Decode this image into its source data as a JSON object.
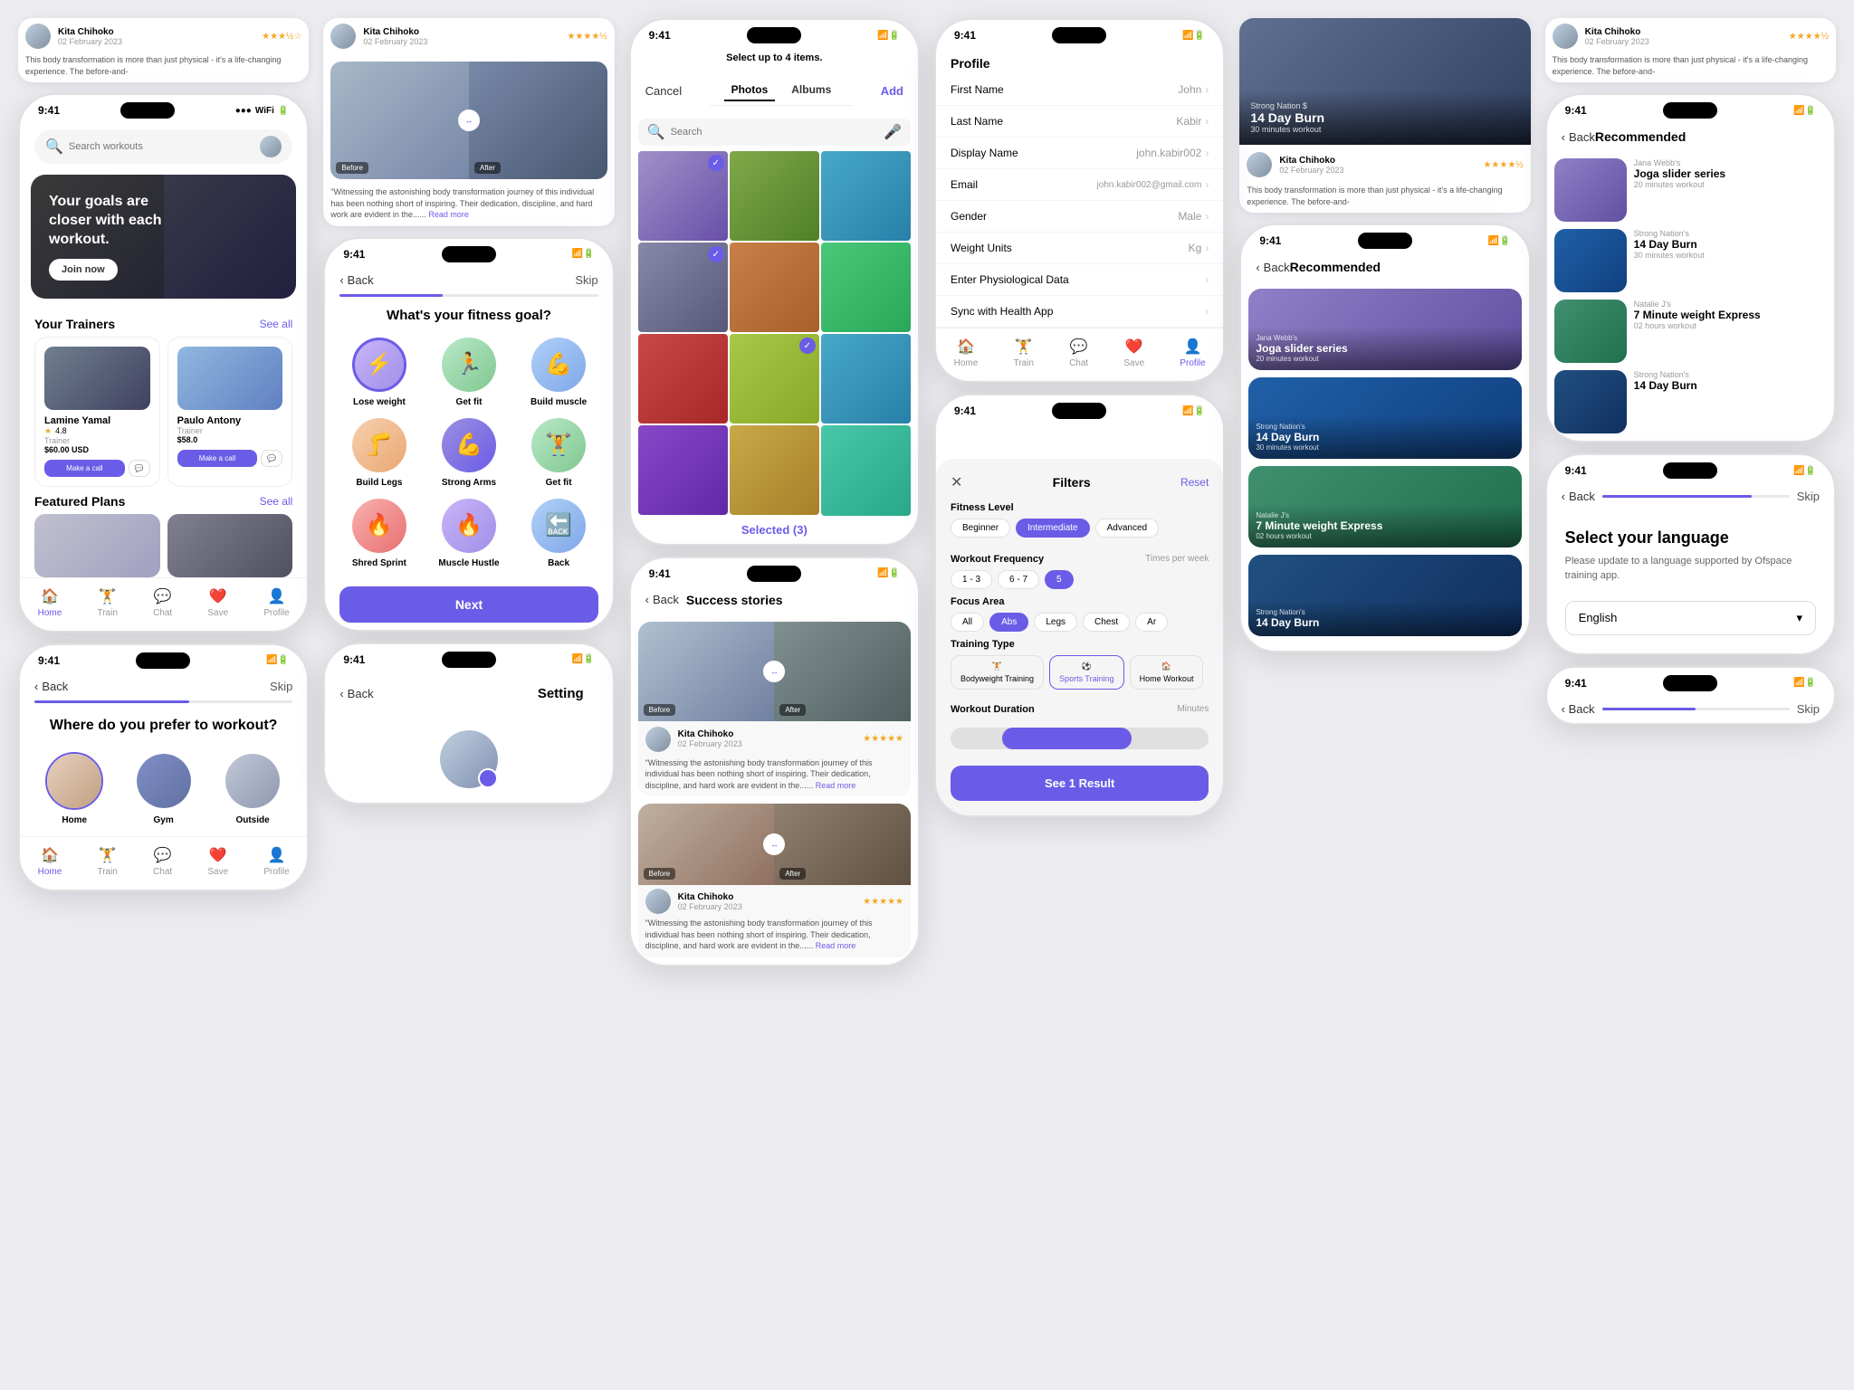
{
  "colors": {
    "primary": "#6B5CE7",
    "accent": "#f5a623",
    "bg": "#ebebf0",
    "white": "#ffffff"
  },
  "screen1": {
    "time": "9:41",
    "hero": {
      "title": "Your goals are closer with each workout.",
      "joinBtn": "Join now"
    },
    "trainers": {
      "sectionTitle": "Your Trainers",
      "seeAll": "See all",
      "list": [
        {
          "name": "Lamine Yamal",
          "role": "Trainer",
          "price": "$60.00 USD",
          "rating": "4.8",
          "btnLabel": "Make a call"
        },
        {
          "name": "Paulo Antony",
          "role": "Trainer",
          "price": "$58.0",
          "btnLabel": "Make a call"
        }
      ]
    },
    "plans": {
      "sectionTitle": "Featured Plans",
      "seeAll": "See all"
    },
    "nav": {
      "items": [
        "Home",
        "Train",
        "Chat",
        "Save",
        "Profile"
      ]
    },
    "searchPlaceholder": "Search workouts"
  },
  "screen2": {
    "time": "9:41",
    "title": "What's your fitness goal?",
    "back": "Back",
    "skip": "Skip",
    "goals": [
      {
        "label": "Lose weight",
        "color": "purple"
      },
      {
        "label": "Get fit",
        "color": "green"
      },
      {
        "label": "Build muscle",
        "color": "blue"
      },
      {
        "label": "Build Legs",
        "color": "orange"
      },
      {
        "label": "Strong Arms",
        "color": "pink"
      },
      {
        "label": "Get fit",
        "color": "green"
      },
      {
        "label": "Shred Sprint",
        "color": "red"
      },
      {
        "label": "Muscle Hustle",
        "color": "purple"
      },
      {
        "label": "Back",
        "color": "blue"
      }
    ],
    "nextBtn": "Next"
  },
  "screen3": {
    "time": "9:41",
    "title": "Where do you prefer to workout?",
    "back": "Back",
    "skip": "Skip",
    "locations": [
      {
        "label": "Home",
        "selected": true
      },
      {
        "label": "Gym",
        "selected": false
      },
      {
        "label": "Outside",
        "selected": false
      }
    ]
  },
  "screen4": {
    "time": "9:41",
    "selectUpTo": "Select up to 4 items.",
    "cancel": "Cancel",
    "add": "Add",
    "tabs": [
      "Photos",
      "Albums"
    ],
    "selectedCount": "Selected (3)"
  },
  "screen5": {
    "time": "9:41",
    "title": "Success stories",
    "back": "Back",
    "user": {
      "name": "Kita Chihoko",
      "date": "02 February 2023",
      "stars": "★★★★★"
    },
    "quote": "\"Witnessing the astonishing body transformation journey of this individual has been nothing short of inspiring. Their dedication, discipline, and hard work are evident in the......",
    "readMore": "Read more"
  },
  "screen6": {
    "profile": {
      "title": "Profile",
      "fields": [
        {
          "label": "First Name",
          "value": "John"
        },
        {
          "label": "Last Name",
          "value": "Kabir"
        },
        {
          "label": "Display Name",
          "value": "john.kabir002"
        },
        {
          "label": "Email",
          "value": "john.kabir002@gmail.com"
        },
        {
          "label": "Gender",
          "value": "Male"
        },
        {
          "label": "Weight Units",
          "value": "Kg"
        },
        {
          "label": "Enter Physiological Data",
          "value": ""
        },
        {
          "label": "Sync with Health App",
          "value": ""
        }
      ]
    },
    "nav": {
      "items": [
        "Home",
        "Train",
        "Chat",
        "Save",
        "Profile"
      ],
      "active": "Profile"
    }
  },
  "screen7": {
    "time": "9:41",
    "filters": {
      "title": "Filters",
      "reset": "Reset",
      "fitnessLevel": {
        "label": "Fitness Level",
        "options": [
          "Beginner",
          "Intermediate",
          "Advanced"
        ],
        "active": "Intermediate"
      },
      "workoutFrequency": {
        "label": "Workout Frequency",
        "sublabel": "Times per week",
        "options": [
          "1 - 3",
          "6 - 7",
          "5"
        ],
        "active": "5"
      },
      "focusArea": {
        "label": "Focus Area",
        "options": [
          "All",
          "Abs",
          "Legs",
          "Chest",
          "Ar"
        ],
        "active": "Abs"
      },
      "trainingType": {
        "label": "Training Type",
        "options": [
          {
            "label": "Bodyweight Training",
            "icon": "🏋️"
          },
          {
            "label": "Sports Training",
            "icon": "⚽"
          },
          {
            "label": "Home Workout",
            "icon": "🏠"
          }
        ],
        "active": "Sports Training"
      },
      "workoutDuration": {
        "label": "Workout Duration",
        "sublabel": "Minutes"
      },
      "seeResultBtn": "See 1 Result"
    }
  },
  "screen8": {
    "time": "9:41",
    "title": "Recommended",
    "back": "Back",
    "workouts": [
      {
        "subtitle": "Jana Webb's",
        "title": "Joga slider series",
        "duration": "20 minutes workout"
      },
      {
        "subtitle": "Strong Nation's",
        "title": "14 Day Burn",
        "duration": "30 minutes workout"
      },
      {
        "subtitle": "Natalie J's",
        "title": "7 Minute weight Express",
        "duration": "02 hours workout"
      },
      {
        "subtitle": "Strong Nation's",
        "title": "14 Day Burn",
        "duration": ""
      }
    ],
    "featured": {
      "subtitle": "Strong Nation $",
      "title": "14 Day Burn",
      "detail": "30 minutes workout"
    },
    "user": {
      "name": "Kita Chihoko",
      "date": "02 February 2023"
    }
  },
  "screen9": {
    "time": "9:41",
    "title": "Setting",
    "back": "Back"
  },
  "screen10": {
    "time": "9:41",
    "title": "Select your language",
    "subtitle": "Please update to a language supported by Ofspace training app.",
    "back": "Back",
    "skip": "Skip",
    "language": "English"
  },
  "topStoryCard": {
    "user": {
      "name": "Kita Chihoko",
      "date": "02 February 2023",
      "stars": "★★★★½"
    },
    "quote": "\"Witnessing the astonishing body transformation journey of this individual has been nothing short of inspiring. Their dedication, discipline, and hard work are evident in the......",
    "readMore": "Read more"
  },
  "leftColStory": {
    "user": {
      "name": "Kita Chihoko",
      "date": "02 February 2023",
      "stars": "★★★½☆"
    },
    "text": "This body transformation is more than just physical - it's a life-changing experience. The before-and-"
  }
}
